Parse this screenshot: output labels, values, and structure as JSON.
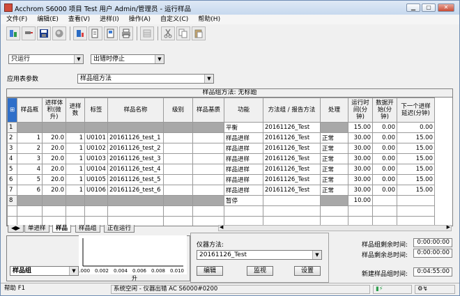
{
  "window": {
    "title": "Acchrom S6000 项目 Test 用户 Admin/管理员 - 运行样品"
  },
  "menu": [
    "文件(F)",
    "编辑(E)",
    "查看(V)",
    "进样(I)",
    "操作(A)",
    "自定义(C)",
    "帮助(H)"
  ],
  "toolbar": {
    "icons": [
      "run-samples-icon",
      "inject-icon",
      "save-icon",
      "stop-icon",
      "sequence-icon",
      "sample-set-icon",
      "report-icon",
      "print-icon",
      "grid-disabled-icon",
      "cut-icon",
      "copy-icon",
      "paste-icon"
    ]
  },
  "filters": {
    "run_mode": "只运行",
    "stop_mode": "出错时停止"
  },
  "method_param": {
    "label": "应用表参数",
    "value": "样品组方法"
  },
  "grid": {
    "title": "样品组方法: 无标题",
    "headers": [
      "样品瓶",
      "进样体积(微升)",
      "进样数",
      "标签",
      "样品名称",
      "级别",
      "样品基质",
      "功能",
      "方法组 / 报告方法",
      "处理",
      "运行时间(分钟)",
      "数据开始(分钟)",
      "下一个进样延迟(分钟)"
    ],
    "rows": [
      {
        "n": "1",
        "vial": "",
        "vol": "",
        "inj": "",
        "label": "",
        "name": "",
        "level": "",
        "matrix": "",
        "func": "平衡",
        "method": "20161126_Test",
        "proc": "",
        "run": "15.00",
        "start": "0.00",
        "delay": "0.00",
        "type": "gray"
      },
      {
        "n": "2",
        "vial": "1",
        "vol": "20.0",
        "inj": "1",
        "label": "U0101",
        "name": "20161126_test_1",
        "level": "",
        "matrix": "",
        "func": "样品进样",
        "method": "20161126_Test",
        "proc": "正常",
        "run": "30.00",
        "start": "0.00",
        "delay": "15.00",
        "type": "white"
      },
      {
        "n": "3",
        "vial": "2",
        "vol": "20.0",
        "inj": "1",
        "label": "U0102",
        "name": "20161126_test_2",
        "level": "",
        "matrix": "",
        "func": "样品进样",
        "method": "20161126_Test",
        "proc": "正常",
        "run": "30.00",
        "start": "0.00",
        "delay": "15.00",
        "type": "white"
      },
      {
        "n": "4",
        "vial": "3",
        "vol": "20.0",
        "inj": "1",
        "label": "U0103",
        "name": "20161126_test_3",
        "level": "",
        "matrix": "",
        "func": "样品进样",
        "method": "20161126_Test",
        "proc": "正常",
        "run": "30.00",
        "start": "0.00",
        "delay": "15.00",
        "type": "white"
      },
      {
        "n": "5",
        "vial": "4",
        "vol": "20.0",
        "inj": "1",
        "label": "U0104",
        "name": "20161126_test_4",
        "level": "",
        "matrix": "",
        "func": "样品进样",
        "method": "20161126_Test",
        "proc": "正常",
        "run": "30.00",
        "start": "0.00",
        "delay": "15.00",
        "type": "white"
      },
      {
        "n": "6",
        "vial": "5",
        "vol": "20.0",
        "inj": "1",
        "label": "U0105",
        "name": "20161126_test_5",
        "level": "",
        "matrix": "",
        "func": "样品进样",
        "method": "20161126_Test",
        "proc": "正常",
        "run": "30.00",
        "start": "0.00",
        "delay": "15.00",
        "type": "white"
      },
      {
        "n": "7",
        "vial": "6",
        "vol": "20.0",
        "inj": "1",
        "label": "U0106",
        "name": "20161126_test_6",
        "level": "",
        "matrix": "",
        "func": "样品进样",
        "method": "20161126_Test",
        "proc": "正常",
        "run": "30.00",
        "start": "0.00",
        "delay": "15.00",
        "type": "white"
      },
      {
        "n": "8",
        "vial": "",
        "vol": "",
        "inj": "",
        "label": "",
        "name": "",
        "level": "",
        "matrix": "",
        "func": "暂停",
        "method": "",
        "proc": "",
        "run": "10.00",
        "start": "",
        "delay": "",
        "type": "gray"
      },
      {
        "n": "",
        "vial": "",
        "vol": "",
        "inj": "",
        "label": "",
        "name": "",
        "level": "",
        "matrix": "",
        "func": "",
        "method": "",
        "proc": "",
        "run": "",
        "start": "",
        "delay": "",
        "type": "white"
      },
      {
        "n": "",
        "vial": "",
        "vol": "",
        "inj": "",
        "label": "",
        "name": "",
        "level": "",
        "matrix": "",
        "func": "",
        "method": "",
        "proc": "",
        "run": "",
        "start": "",
        "delay": "",
        "type": "white"
      }
    ]
  },
  "tabs": [
    "单进样",
    "样品",
    "样品组",
    "正在运行"
  ],
  "left_panel": {
    "group_select": "样品组",
    "axis_ticks": [
      "0.000",
      "0.002",
      "0.004",
      "0.006",
      "0.008",
      "0.010"
    ],
    "axis_unit": "升"
  },
  "instrument": {
    "label": "仪器方法:",
    "value": "20161126_Test",
    "buttons": {
      "edit": "编辑",
      "monitor": "监视",
      "setup": "设置"
    }
  },
  "timers": [
    {
      "label": "样品组剩余时间:",
      "value": "0:00:00:00"
    },
    {
      "label": "样品剩余总时间:",
      "value": "0:00:00:00"
    },
    {
      "label": "新建样品组时间:",
      "value": "0:04:55:00"
    }
  ],
  "status": {
    "help": "帮助 F1",
    "system": "系统空闲 - 仪器出错 AC S6000#0200"
  }
}
